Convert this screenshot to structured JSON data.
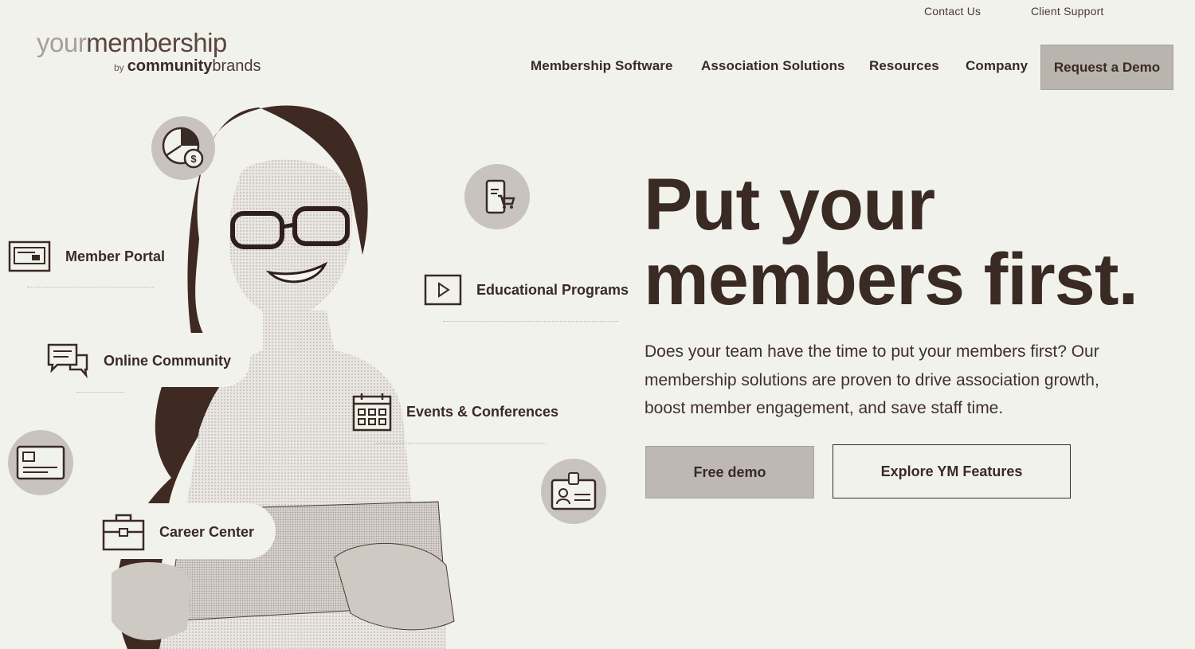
{
  "utility_nav": {
    "contact": "Contact Us",
    "support": "Client Support"
  },
  "logo": {
    "main_light": "your",
    "main": "membership",
    "by": "by",
    "brand_a": "community",
    "brand_b": "brands"
  },
  "nav": {
    "items": [
      {
        "label": "Membership Software"
      },
      {
        "label": "Association Solutions"
      },
      {
        "label": "Resources"
      },
      {
        "label": "Company"
      }
    ],
    "cta": "Request a Demo"
  },
  "hero": {
    "headline_line1": "Put your",
    "headline_line2": "members first.",
    "subtext": "Does your team have the time to put your members first? Our membership solutions are proven to drive association growth, boost member engagement, and save staff time.",
    "primary_button": "Free demo",
    "secondary_button": "Explore YM Features"
  },
  "features": {
    "member_portal": "Member Portal",
    "online_community": "Online Community",
    "educational_programs": "Educational Programs",
    "events": "Events & Conferences",
    "career_center": "Career Center"
  },
  "icons": {
    "finance": "pie-chart-dollar-icon",
    "ecommerce": "mobile-cart-icon",
    "portal": "browser-window-icon",
    "video": "play-video-icon",
    "chat": "chat-bubbles-icon",
    "calendar": "calendar-icon",
    "card": "id-card-icon",
    "badge": "badge-icon",
    "briefcase": "briefcase-icon"
  },
  "colors": {
    "background": "#f2f2ec",
    "text": "#3a2a24",
    "button_fill": "#bdb8b3"
  }
}
